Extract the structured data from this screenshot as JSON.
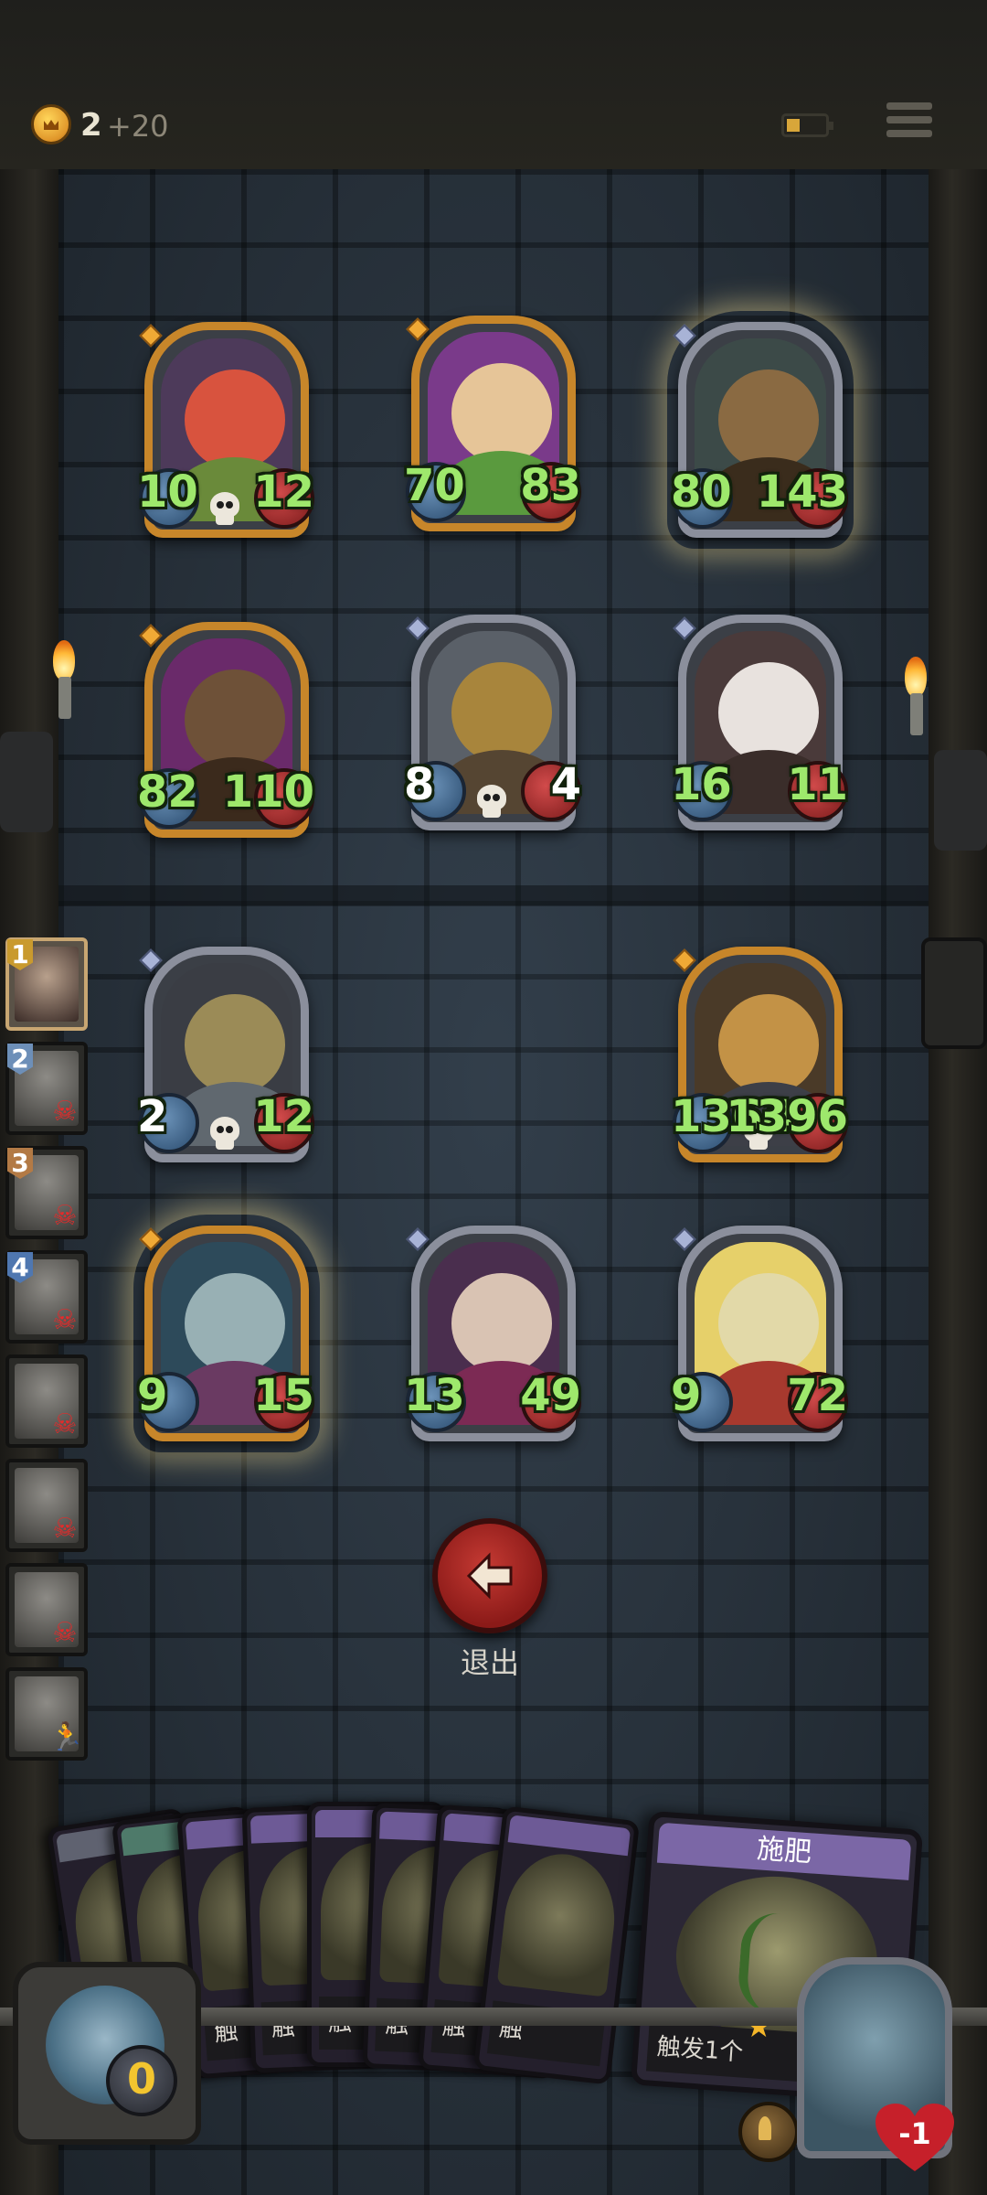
{
  "top_bar": {
    "gold": "2",
    "gold_increment": "+20",
    "battery_icon": "battery-low-icon",
    "menu_icon": "hamburger-menu-icon"
  },
  "board": {
    "enemy_units": [
      {
        "attack": "10",
        "health": "12",
        "frame": "gold",
        "has_skull": true,
        "portrait": "red-devil-with-skull"
      },
      {
        "attack": "70",
        "health": "83",
        "frame": "gold",
        "has_skull": false,
        "portrait": "leaf-sprout-girl"
      },
      {
        "attack": "80",
        "health": "143",
        "frame": "silver",
        "has_skull": false,
        "portrait": "evil-treant",
        "glow": true
      },
      {
        "attack": "82",
        "health": "110",
        "frame": "gold",
        "has_skull": false,
        "portrait": "wooden-totem"
      },
      {
        "attack": "8",
        "health": "4",
        "frame": "silver",
        "has_skull": true,
        "portrait": "mechanical-beast",
        "health_color": "white",
        "attack_color": "white"
      },
      {
        "attack": "16",
        "health": "11",
        "frame": "silver",
        "has_skull": false,
        "portrait": "masked-rabbit"
      }
    ],
    "ally_units": [
      {
        "attack": "2",
        "health": "12",
        "frame": "silver",
        "has_skull": true,
        "portrait": "bell-robot",
        "attack_color": "white"
      },
      {
        "attack": "1364",
        "health": "1396",
        "frame": "gold",
        "has_skull": true,
        "portrait": "armored-knight"
      },
      {
        "attack": "9",
        "health": "15",
        "frame": "gold",
        "has_skull": false,
        "portrait": "elf-sorceress",
        "glow": true
      },
      {
        "attack": "13",
        "health": "49",
        "frame": "silver",
        "has_skull": false,
        "portrait": "circus-clown"
      },
      {
        "attack": "9",
        "health": "72",
        "frame": "silver",
        "has_skull": false,
        "portrait": "bearded-warrior"
      }
    ]
  },
  "turn_order": [
    {
      "number": "1",
      "status": "active"
    },
    {
      "number": "2",
      "status": "defeated"
    },
    {
      "number": "3",
      "status": "defeated"
    },
    {
      "number": "4",
      "status": "defeated"
    },
    {
      "number": "",
      "status": "defeated"
    },
    {
      "number": "",
      "status": "defeated"
    },
    {
      "number": "",
      "status": "defeated"
    },
    {
      "number": "",
      "status": "fleeing"
    }
  ],
  "exit": {
    "label": "退出",
    "icon": "arrow-left-icon"
  },
  "hand": {
    "cards": [
      {
        "text": "触"
      },
      {
        "text": "触"
      },
      {
        "text": "触"
      },
      {
        "text": "触"
      },
      {
        "text": "触"
      },
      {
        "text": "触"
      },
      {
        "text": "触"
      },
      {
        "text": "触"
      }
    ],
    "focused_card": {
      "title": "施肥",
      "text": "触发1个"
    }
  },
  "deck": {
    "count": "0"
  },
  "hero": {
    "health": "-1",
    "portrait": "zombie-hero"
  },
  "colors": {
    "stat_green": "#9ee86c",
    "gold_frame": "#c7862a",
    "silver_frame": "#8b8f9c",
    "exit_red": "#a82420"
  }
}
